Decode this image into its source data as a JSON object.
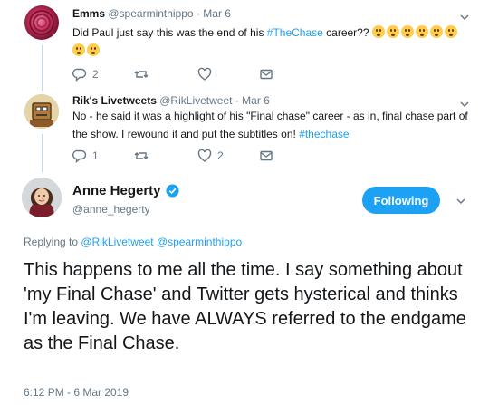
{
  "tweet1": {
    "name": "Emms",
    "handle": "@spearminthippo",
    "dot_date": "· Mar 6",
    "text": "Did Paul just say this was the end of his ",
    "hashtag": "#TheChase",
    "text_after": " career??",
    "emoji_count": 8,
    "replies": "2",
    "retweets": "",
    "likes": ""
  },
  "tweet2": {
    "name": "Rik's Livetweets",
    "handle": "@RikLivetweet",
    "dot_date": "· Mar 6",
    "text": "No - he said it was a highlight of his \"Final chase\" career - as in, final chase part of the show.  I rewound it and put the subtitles on! ",
    "hashtag": "#thechase",
    "replies": "1",
    "retweets": "",
    "likes": "2"
  },
  "main": {
    "name": "Anne Hegerty",
    "handle": "@anne_hegerty",
    "follow_label": "Following",
    "replying_prefix": "Replying to ",
    "replying_to_1": "@RikLivetweet",
    "replying_to_2": "@spearminthippo",
    "text": "This happens to me all the time.  I say something about 'my Final Chase' and Twitter gets hysterical and thinks I'm leaving.  We have ALWAYS referred to the endgame as the Final Chase.",
    "timestamp": "6:12 PM - 6 Mar 2019"
  },
  "colors": {
    "accent": "#1da1f2",
    "muted": "#657786",
    "thread_line": "#ccd6dd"
  }
}
